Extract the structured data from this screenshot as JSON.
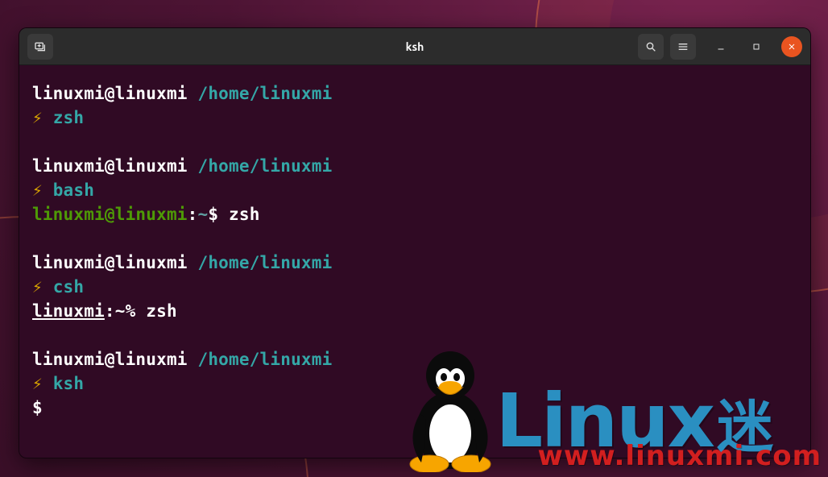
{
  "window": {
    "title": "ksh"
  },
  "terminal": {
    "block1": {
      "userhost": "linuxmi@linuxmi",
      "path": "/home/linuxmi",
      "cmd": "zsh"
    },
    "block2": {
      "userhost": "linuxmi@linuxmi",
      "path": "/home/linuxmi",
      "cmd": "bash",
      "bash_userhost": "linuxmi@linuxmi",
      "bash_sep": ":",
      "bash_tilde": "~",
      "bash_prompt": "$ ",
      "bash_cmd": "zsh"
    },
    "block3": {
      "userhost": "linuxmi@linuxmi",
      "path": "/home/linuxmi",
      "cmd": "csh",
      "csh_host": "linuxmi",
      "csh_tail": ":~% ",
      "csh_cmd": "zsh"
    },
    "block4": {
      "userhost": "linuxmi@linuxmi",
      "path": "/home/linuxmi",
      "cmd": "ksh",
      "ksh_prompt": "$ "
    },
    "bolt": "⚡"
  },
  "watermark": {
    "brand_latin": "Linux",
    "brand_cn": "迷",
    "url": "www.linuxmi.com"
  },
  "colors": {
    "terminal_bg": "#300a24",
    "titlebar_bg": "#2c2c2c",
    "close_btn": "#e95420",
    "path_cyan": "#34a7a7",
    "bolt_yellow": "#d9a400",
    "bash_green": "#4e9a06",
    "watermark_blue": "#2a8fc1",
    "watermark_red": "#d21f1f"
  }
}
